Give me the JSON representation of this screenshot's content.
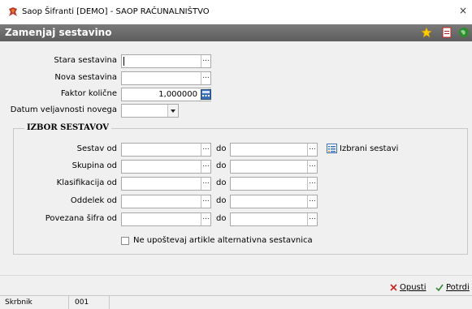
{
  "window": {
    "title": "Saop Šifranti [DEMO] - SAOP RAČUNALNIŠTVO",
    "close": "×"
  },
  "form": {
    "title": "Zamenjaj sestavino"
  },
  "fields": {
    "stara_label": "Stara sestavina",
    "nova_label": "Nova sestavina",
    "faktor_label": "Faktor količne",
    "faktor_value": "1,000000",
    "datum_label": "Datum veljavnosti novega"
  },
  "group": {
    "title": "IZBOR SESTAVOV",
    "do_label": "do",
    "rows": [
      {
        "label": "Sestav od"
      },
      {
        "label": "Skupina od"
      },
      {
        "label": "Klasifikacija od"
      },
      {
        "label": "Oddelek od"
      },
      {
        "label": "Povezana šifra od"
      }
    ],
    "izbrani_label": "Izbrani sestavi",
    "checkbox_label": "Ne upoštevaj artikle alternativna sestavnica"
  },
  "lookup_glyph": "...",
  "buttons": {
    "opusti": "Opusti",
    "potrdi": "Potrdi"
  },
  "status": {
    "user": "Skrbnik",
    "code": "001"
  },
  "colors": {
    "accent_green": "#2e8b2e",
    "cancel_red": "#cc2222",
    "header_bg": "#6b6b6b"
  }
}
